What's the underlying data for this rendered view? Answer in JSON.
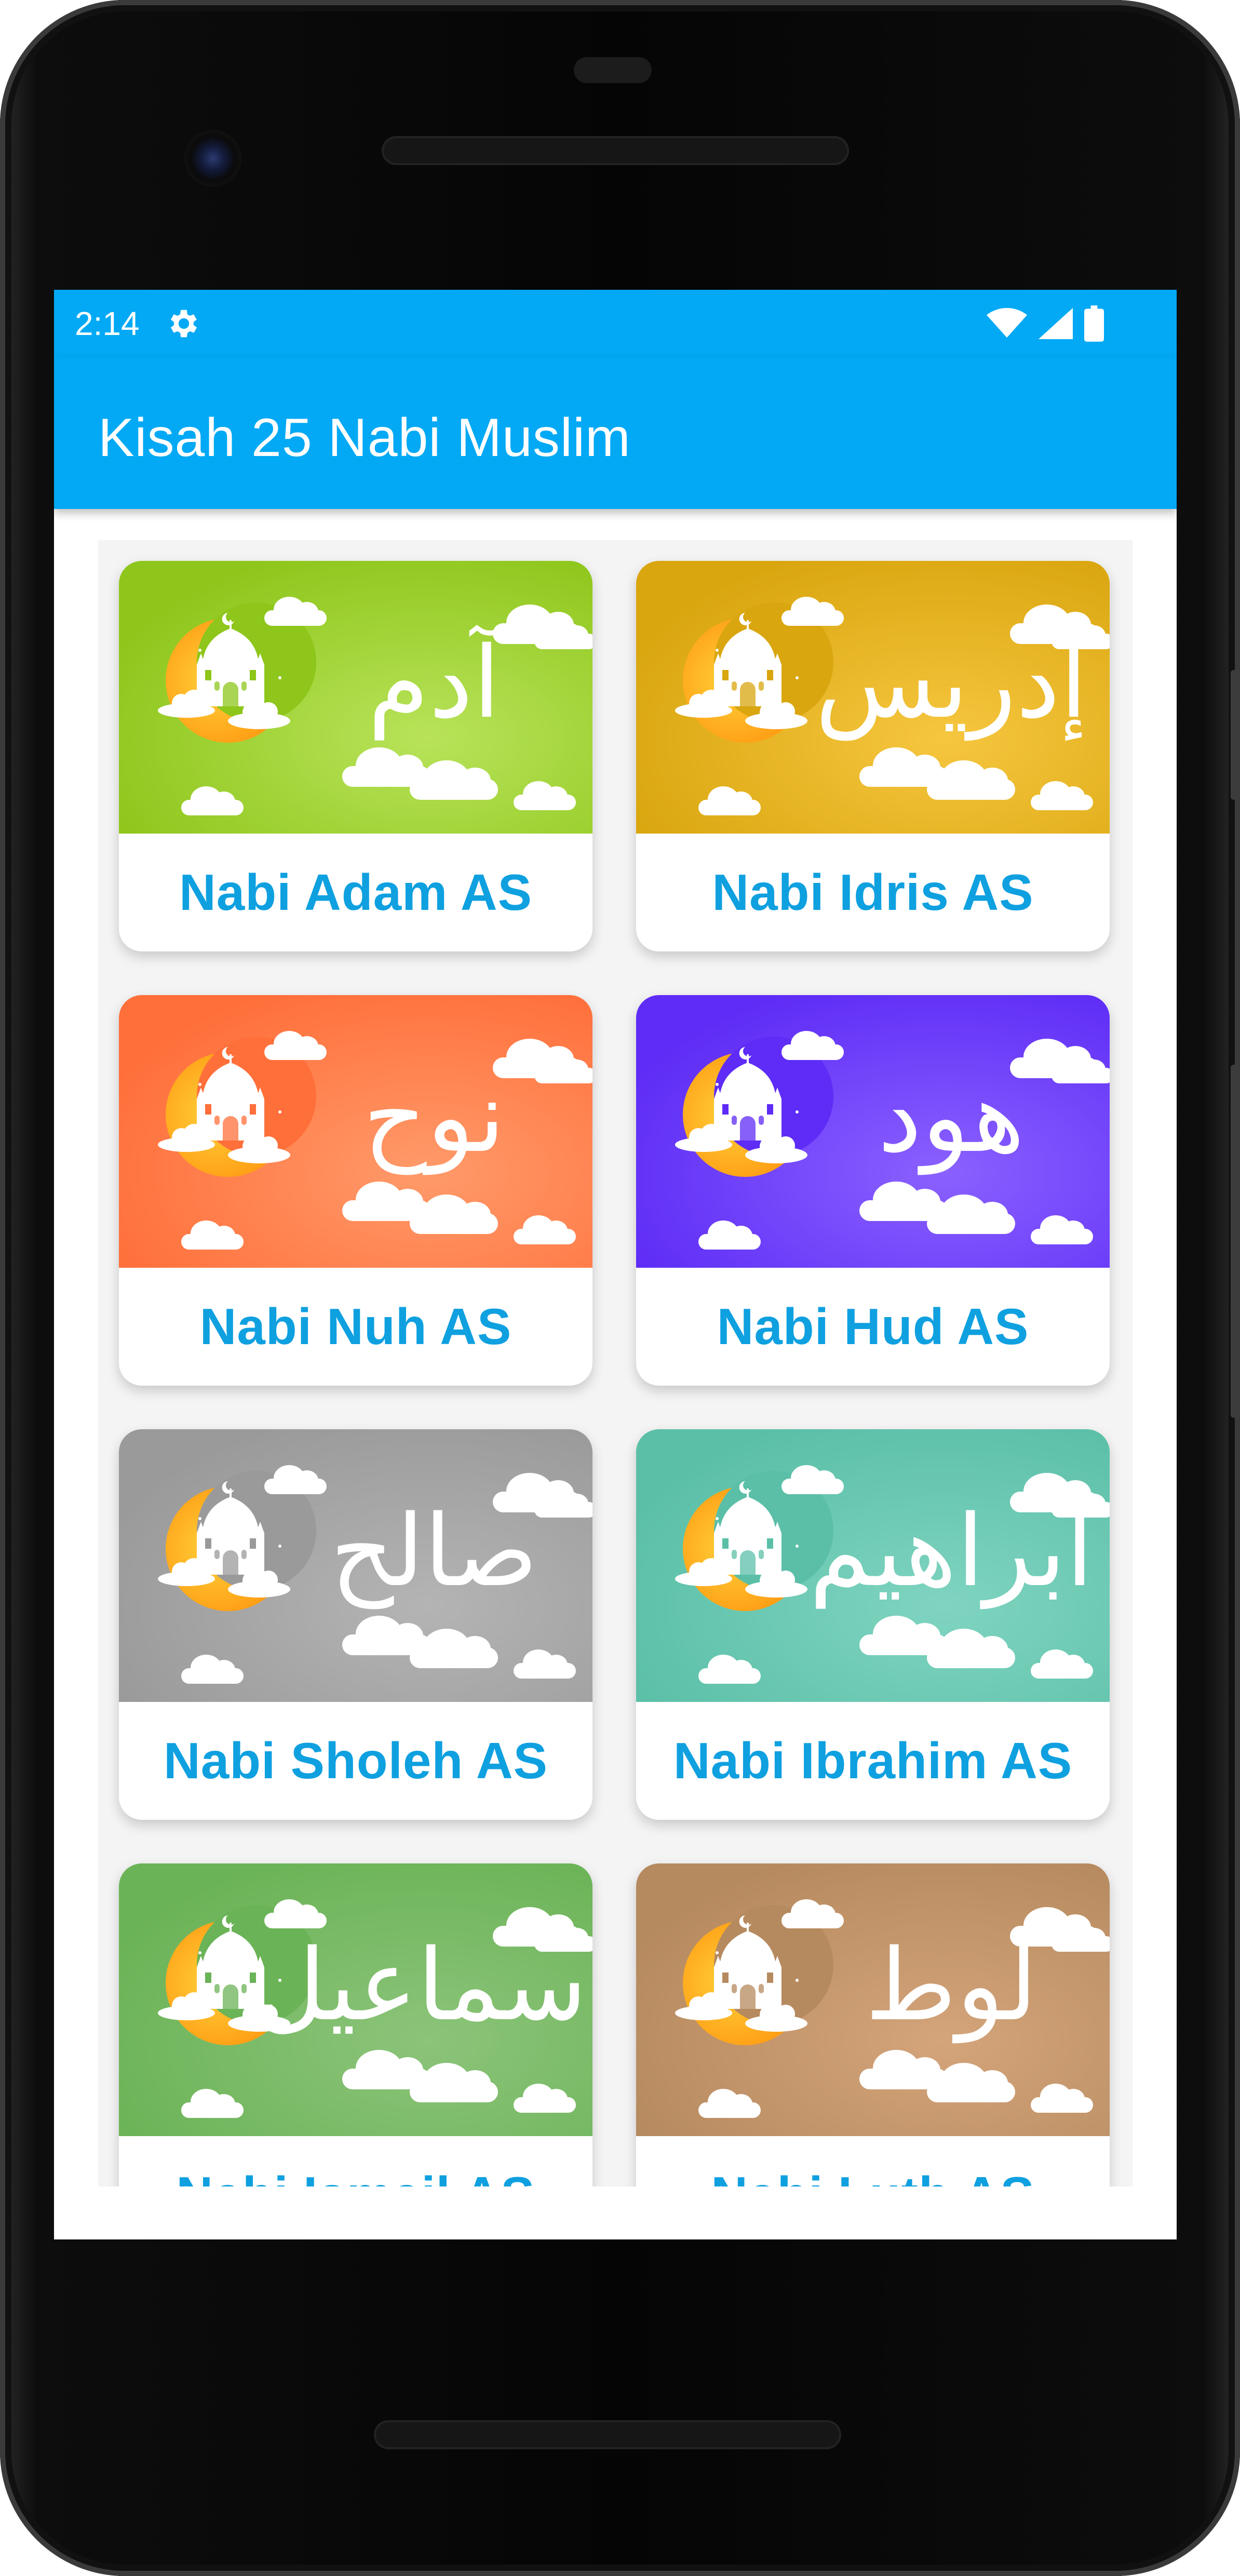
{
  "status_bar": {
    "time": "2:14",
    "icons": [
      "gear-icon",
      "wifi-icon",
      "signal-icon",
      "battery-icon"
    ]
  },
  "app_bar": {
    "title": "Kisah 25 Nabi Muslim",
    "color": "#03a9f4"
  },
  "prophets": [
    {
      "label": "Nabi Adam AS",
      "arabic": "آدم",
      "color_from": "#8ec61b",
      "color_to": "#b8e35a"
    },
    {
      "label": "Nabi Idris AS",
      "arabic": "إدريس",
      "color_from": "#d9a60f",
      "color_to": "#f6c63f"
    },
    {
      "label": "Nabi Nuh AS",
      "arabic": "نوح",
      "color_from": "#ff6f3a",
      "color_to": "#ff9a6a"
    },
    {
      "label": "Nabi Hud AS",
      "arabic": "هود",
      "color_from": "#5e2cf6",
      "color_to": "#8a61ff"
    },
    {
      "label": "Nabi Sholeh AS",
      "arabic": "صالح",
      "color_from": "#9a9a9a",
      "color_to": "#b4b4b4"
    },
    {
      "label": "Nabi Ibrahim AS",
      "arabic": "ابراهيم",
      "color_from": "#5bbfa7",
      "color_to": "#7fd4c0"
    },
    {
      "label": "Nabi Ismail AS",
      "arabic": "اسماعيل",
      "color_from": "#6bb357",
      "color_to": "#8cc47a"
    },
    {
      "label": "Nabi Luth AS",
      "arabic": "لوط",
      "color_from": "#b68a5f",
      "color_to": "#d4a47a"
    }
  ]
}
